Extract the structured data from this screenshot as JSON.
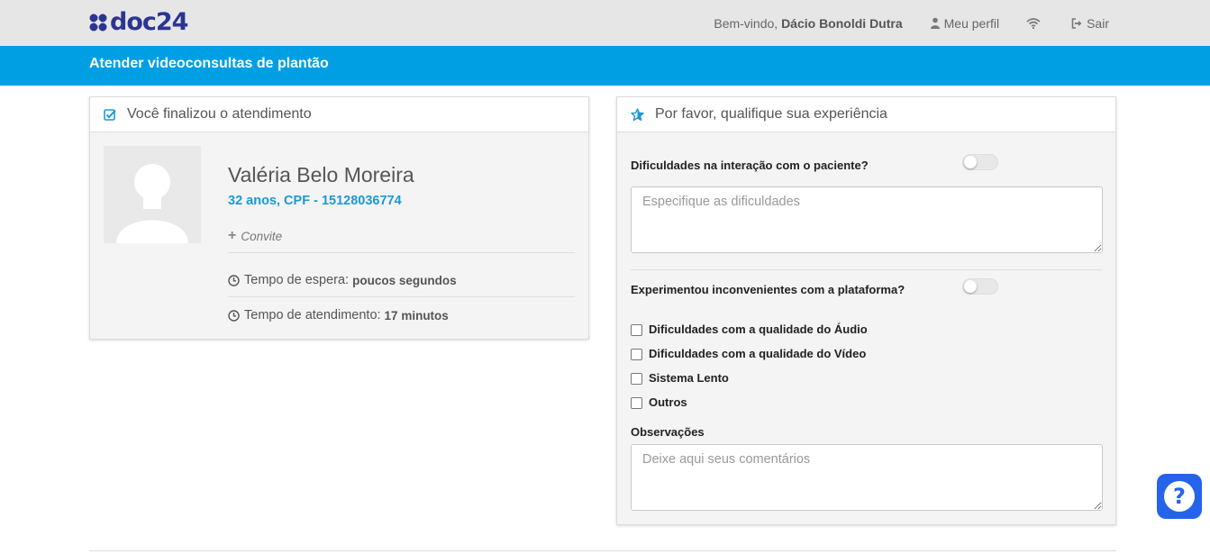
{
  "header": {
    "logo_text": "doc24",
    "welcome_prefix": "Bem-vindo,",
    "user_name": "Dácio Bonoldi Dutra",
    "profile_label": "Meu perfil",
    "logout_label": "Sair",
    "brand_color": "#2c3593"
  },
  "banner": {
    "title": "Atender videoconsultas de plantão",
    "color": "#009fe3"
  },
  "left_panel": {
    "title": "Você finalizou o atendimento",
    "patient_name": "Valéria Belo Moreira",
    "patient_info": "32 anos, CPF - 15128036774",
    "invite_label": "Convite",
    "wait_label": "Tempo de espera:",
    "wait_value": "poucos segundos",
    "service_label": "Tempo de atendimento:",
    "service_value": "17 minutos"
  },
  "right_panel": {
    "title": "Por favor, qualifique sua experiência",
    "q1_label": "Dificuldades na interação com o paciente?",
    "q1_toggle_on": false,
    "q1_placeholder": "Especifique as dificuldades",
    "q2_label": "Experimentou inconvenientes com a plataforma?",
    "q2_toggle_on": false,
    "options": [
      {
        "label": "Dificuldades com a qualidade do Áudio",
        "checked": false
      },
      {
        "label": "Dificuldades com a qualidade do Vídeo",
        "checked": false
      },
      {
        "label": "Sistema Lento",
        "checked": false
      },
      {
        "label": "Outros",
        "checked": false
      }
    ],
    "observations_label": "Observações",
    "observations_placeholder": "Deixe aqui seus comentários"
  },
  "help": {
    "icon": "question-icon",
    "glyph": "?"
  }
}
